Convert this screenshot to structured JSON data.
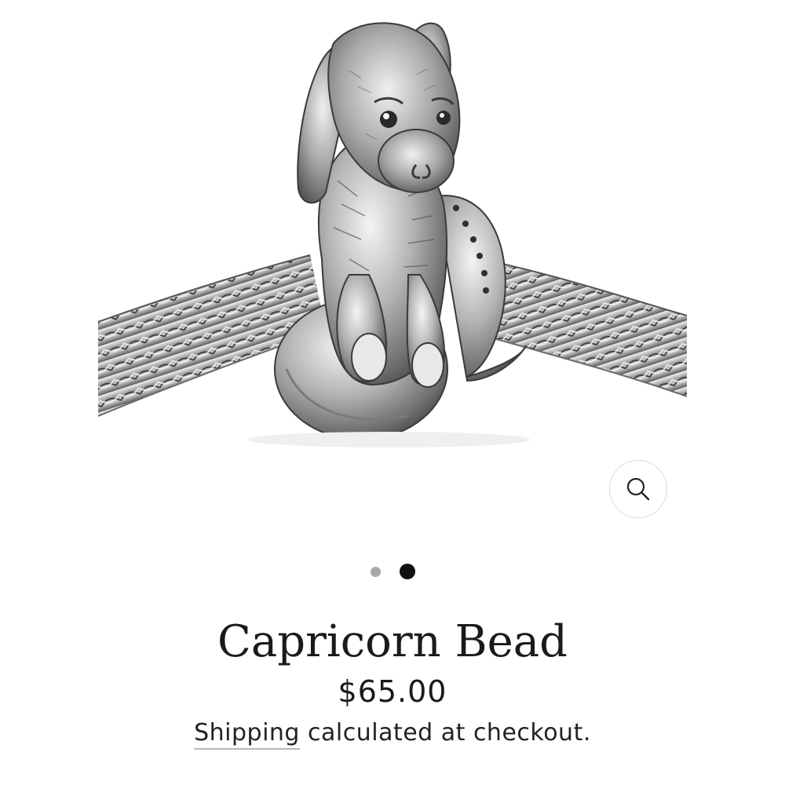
{
  "gallery": {
    "image_alt": "Capricorn Bead",
    "slide_count": 2,
    "active_slide": 2,
    "zoom_icon": "search-icon"
  },
  "product": {
    "title": "Capricorn Bead",
    "price": "$65.00",
    "shipping_link": "Shipping",
    "shipping_rest": " calculated at checkout."
  },
  "colors": {
    "text": "#1a1a1a",
    "dot_active": "#111111",
    "dot_inactive": "#a8a8a8",
    "silver_light": "#e6e6e6",
    "silver_dark": "#4a4a4a"
  }
}
